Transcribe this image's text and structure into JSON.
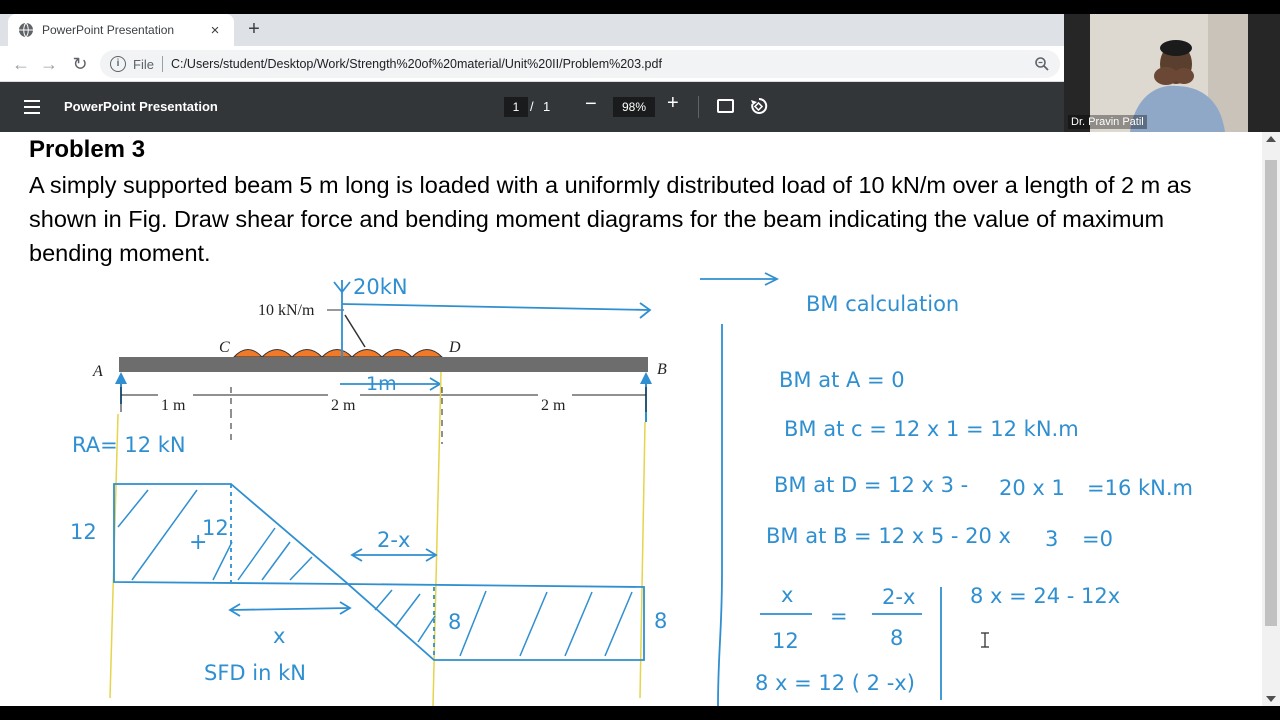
{
  "browser": {
    "tab_title": "PowerPoint Presentation",
    "tab_close": "×",
    "new_tab": "+",
    "file_label": "File",
    "url": "C:/Users/student/Desktop/Work/Strength%20of%20material/Unit%20II/Problem%203.pdf"
  },
  "pdf_toolbar": {
    "title": "PowerPoint Presentation",
    "page_current": "1",
    "page_sep": "/",
    "page_total": "1",
    "zoom": "98%",
    "zoom_minus": "−",
    "zoom_plus": "+"
  },
  "webcam": {
    "name": "Dr. Pravin Patil"
  },
  "content": {
    "problem_title": "Problem 3",
    "problem_text": "A simply supported beam 5 m long is loaded with a uniformly distributed load of 10 kN/m over a length of 2 m as shown in Fig. Draw shear force and bending moment diagrams for the beam indicating the value of maximum bending moment."
  },
  "figure": {
    "udl_label": "10 kN/m",
    "point_A": "A",
    "point_B": "B",
    "point_C": "C",
    "point_D": "D",
    "dim_1": "1 m",
    "dim_2": "2 m",
    "dim_3": "2 m"
  },
  "annotations": {
    "resultant": "20kN",
    "half_span": "1m",
    "reaction_a": "RA= 12 kN",
    "sfd_left": "12",
    "sfd_left_inner": "12",
    "sfd_plus": "+",
    "sfd_two_minus_x": "2-x",
    "sfd_x": "x",
    "sfd_right_inner": "8",
    "sfd_right": "8",
    "sfd_caption": "SFD in kN",
    "bm_heading": "BM calculation",
    "bm_a": "BM at A = 0",
    "bm_c": "BM at c = 12 x 1 = 12 kN.m",
    "bm_d_1": "BM at D = 12 x 3 -",
    "bm_d_2": "20 x 1",
    "bm_d_3": "=16 kN.m",
    "bm_b_1": "BM at B = 12 x 5 - 20 x",
    "bm_b_2": "3",
    "bm_b_3": "=0",
    "frac_x": "x",
    "frac_eq": "=",
    "frac_2x": "2-x",
    "frac_12": "12",
    "frac_8": "8",
    "eq_8x": "8 x = 24 - 12x",
    "eq_bottom": "8 x = 12 ( 2 -x)"
  },
  "colors": {
    "ink": "#2f8fd0",
    "beam": "#6d6d6d",
    "udl": "#f07a2a",
    "sfd_line": "#e6d44a",
    "pdf_toolbar": "#323639"
  }
}
